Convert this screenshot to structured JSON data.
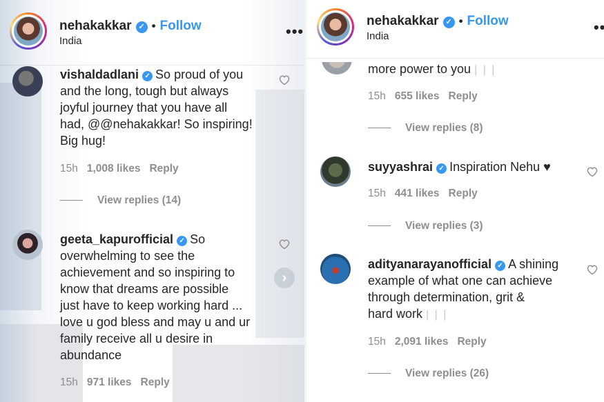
{
  "left": {
    "header": {
      "username": "nehakakkar",
      "dot": "•",
      "follow_label": "Follow",
      "location": "India",
      "more": "•••"
    },
    "comments": [
      {
        "username": "vishaldadlani",
        "lines": [
          "So proud of you",
          "and the long, tough but always",
          "joyful journey that you have all",
          "had, @@nehakakkar! So inspiring!",
          "Big hug!"
        ],
        "time": "15h",
        "likes": "1,008 likes",
        "reply": "Reply",
        "view_replies": "View replies (14)"
      },
      {
        "username": "geeta_kapurofficial",
        "lines": [
          "So",
          "overwhelming to see the",
          "achievement and so inspiring to",
          "know that dreams are possible",
          "just have to keep working hard ...",
          "love u god bless and may u and ur",
          "family receive all u desire in",
          "abundance"
        ],
        "time": "15h",
        "likes": "971 likes",
        "reply": "Reply"
      }
    ]
  },
  "right": {
    "header": {
      "username": "nehakakkar",
      "dot": "•",
      "follow_label": "Follow",
      "location": "India",
      "more": "•••"
    },
    "partial_comment": {
      "text": "more power to you",
      "time": "15h",
      "likes": "655 likes",
      "reply": "Reply",
      "view_replies": "View replies (8)"
    },
    "comments": [
      {
        "username": "suyyashrai",
        "text": "Inspiration Nehu",
        "emoji": "♥",
        "time": "15h",
        "likes": "441 likes",
        "reply": "Reply",
        "view_replies": "View replies (3)"
      },
      {
        "username": "adityanarayanofficial",
        "lines": [
          "A shining",
          "example of what one can achieve",
          "through determination, grit &",
          "hard work"
        ],
        "time": "15h",
        "likes": "2,091 likes",
        "reply": "Reply",
        "view_replies": "View replies (26)"
      }
    ]
  },
  "icons": {
    "verified": "✓",
    "heart": "heart-outline-icon",
    "chevron": "›",
    "emoji_placeholder": "| | |"
  },
  "colors": {
    "link": "#3897f0",
    "muted": "#8e8e8e",
    "text": "#262626"
  }
}
